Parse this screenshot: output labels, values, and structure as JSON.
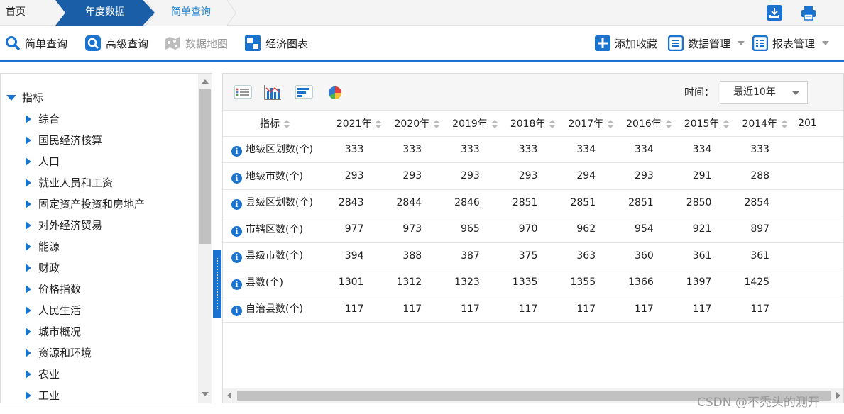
{
  "breadcrumb": {
    "home": "首页",
    "year": "年度数据",
    "simple": "简单查询"
  },
  "toolbar": {
    "simple_query": "简单查询",
    "advanced_query": "高级查询",
    "data_map": "数据地图",
    "econ_chart": "经济图表",
    "add_favorite": "添加收藏",
    "data_manage": "数据管理",
    "report_manage": "报表管理"
  },
  "tree": {
    "root": "指标",
    "items": [
      "综合",
      "国民经济核算",
      "人口",
      "就业人员和工资",
      "固定资产投资和房地产",
      "对外经济贸易",
      "能源",
      "财政",
      "价格指数",
      "人民生活",
      "城市概况",
      "资源和环境",
      "农业",
      "工业"
    ]
  },
  "panel": {
    "time_label": "时间：",
    "time_value": "最近10年"
  },
  "table": {
    "name_header": "指标",
    "years": [
      "2021年",
      "2020年",
      "2019年",
      "2018年",
      "2017年",
      "2016年",
      "2015年",
      "2014年",
      "201"
    ],
    "rows": [
      {
        "name": "地级区划数(个)",
        "values": [
          "333",
          "333",
          "333",
          "333",
          "334",
          "334",
          "334",
          "333"
        ]
      },
      {
        "name": "地级市数(个)",
        "values": [
          "293",
          "293",
          "293",
          "293",
          "294",
          "293",
          "291",
          "288"
        ]
      },
      {
        "name": "县级区划数(个)",
        "values": [
          "2843",
          "2844",
          "2846",
          "2851",
          "2851",
          "2851",
          "2850",
          "2854"
        ]
      },
      {
        "name": "市辖区数(个)",
        "values": [
          "977",
          "973",
          "965",
          "970",
          "962",
          "954",
          "921",
          "897"
        ]
      },
      {
        "name": "县级市数(个)",
        "values": [
          "394",
          "388",
          "387",
          "375",
          "363",
          "360",
          "361",
          "361"
        ]
      },
      {
        "name": "县数(个)",
        "values": [
          "1301",
          "1312",
          "1323",
          "1335",
          "1355",
          "1366",
          "1397",
          "1425"
        ]
      },
      {
        "name": "自治县数(个)",
        "values": [
          "117",
          "117",
          "117",
          "117",
          "117",
          "117",
          "117",
          "117"
        ]
      }
    ]
  },
  "watermark": "CSDN @不秃头的测开",
  "colors": {
    "accent": "#1a73cf",
    "breadcrumb_active": "#1b5ea8"
  }
}
